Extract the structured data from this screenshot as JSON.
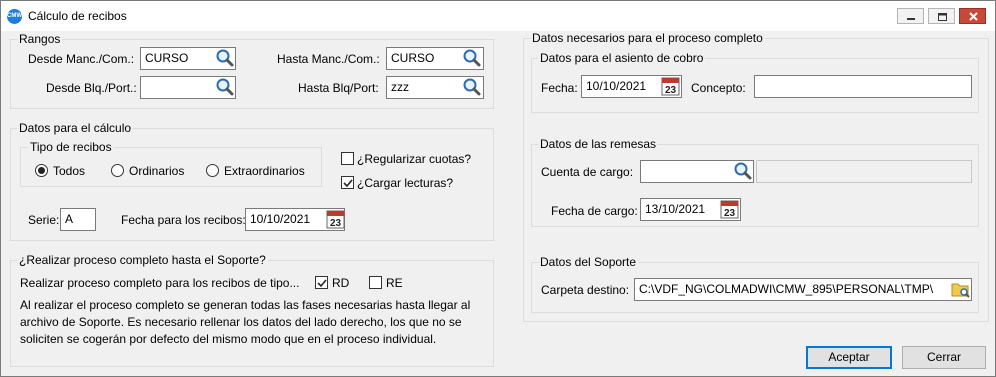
{
  "window": {
    "title": "Cálculo de recibos",
    "app_icon_text": "CMW"
  },
  "rangos": {
    "legend": "Rangos",
    "desde_manc_label": "Desde Manc./Com.:",
    "desde_manc_value": "CURSO",
    "hasta_manc_label": "Hasta Manc./Com.:",
    "hasta_manc_value": "CURSO",
    "desde_blq_label": "Desde Blq./Port.:",
    "desde_blq_value": "",
    "hasta_blq_label": "Hasta Blq/Port:",
    "hasta_blq_value": "zzz"
  },
  "calculo": {
    "legend": "Datos para el cálculo",
    "tipo_legend": "Tipo de recibos",
    "radio_todos": "Todos",
    "radio_ordinarios": "Ordinarios",
    "radio_extraordinarios": "Extraordinarios",
    "selected_tipo": "Todos",
    "regularizar_label": "¿Regularizar cuotas?",
    "regularizar_checked": false,
    "cargar_label": "¿Cargar lecturas?",
    "cargar_checked": true,
    "serie_label": "Serie:",
    "serie_value": "A",
    "fecha_label": "Fecha para los recibos:",
    "fecha_value": "10/10/2021"
  },
  "proceso": {
    "legend": "¿Realizar proceso completo hasta el Soporte?",
    "tipo_label": "Realizar proceso completo para los recibos de tipo...",
    "rd_label": "RD",
    "rd_checked": true,
    "re_label": "RE",
    "re_checked": false,
    "description_line1": "Al realizar el proceso completo se generan todas las fases necesarias hasta llegar al",
    "description_line2": "archivo de Soporte. Es necesario rellenar los datos del lado derecho, los que no se",
    "description_line3": "soliciten se cogerán por defecto del mismo modo que en el proceso individual."
  },
  "completo": {
    "legend": "Datos necesarios para el proceso completo",
    "asiento_legend": "Datos para el asiento de cobro",
    "fecha_label": "Fecha:",
    "fecha_value": "10/10/2021",
    "concepto_label": "Concepto:",
    "concepto_value": "",
    "remesas_legend": "Datos de las remesas",
    "cuenta_label": "Cuenta de cargo:",
    "cuenta_value": "",
    "cuenta_desc_value": "",
    "fecha_cargo_label": "Fecha de cargo:",
    "fecha_cargo_value": "13/10/2021",
    "soporte_legend": "Datos del Soporte",
    "carpeta_label": "Carpeta destino:",
    "carpeta_value": "C:\\VDF_NG\\COLMADWI\\CMW_895\\PERSONAL\\TMP\\"
  },
  "buttons": {
    "aceptar": "Aceptar",
    "cerrar": "Cerrar"
  },
  "calendar_day": "23",
  "colors": {
    "accent": "#0078d7",
    "close_button": "#c7493a",
    "window_bg": "#f0f0f0"
  }
}
